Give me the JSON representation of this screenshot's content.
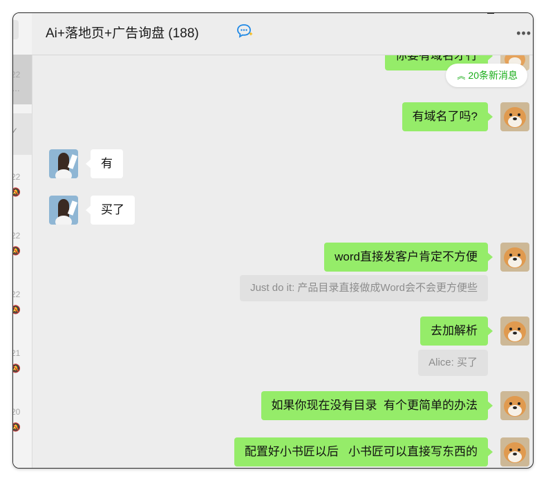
{
  "window": {
    "title": "Ai+落地页+广告询盘 (188)",
    "more_label": "•••"
  },
  "session_strip": {
    "items": [
      {
        "time": "22",
        "preview": "…",
        "state": "active"
      },
      {
        "time": "",
        "preview": "✓",
        "state": "hover"
      },
      {
        "time": "22",
        "preview": "",
        "state": "normal"
      },
      {
        "time": "22",
        "preview": "",
        "state": "normal"
      },
      {
        "time": "22",
        "preview": "",
        "state": "normal"
      },
      {
        "time": "21",
        "preview": "",
        "state": "normal"
      },
      {
        "time": "20",
        "preview": "",
        "state": "normal"
      }
    ]
  },
  "new_messages": {
    "label": "20条新消息",
    "icon": "double-chevron-up-icon"
  },
  "messages": [
    {
      "side": "me",
      "text": "你要有域名才行"
    },
    {
      "side": "me",
      "text": "有域名了吗?"
    },
    {
      "side": "other",
      "text": "有"
    },
    {
      "side": "other",
      "text": "买了"
    },
    {
      "side": "me",
      "text": "word直接发客户肯定不方便",
      "quote": "Just do it: 产品目录直接做成Word会不会更方便些"
    },
    {
      "side": "me",
      "text": "去加解析",
      "quote": "Alice: 买了"
    },
    {
      "side": "me",
      "text": "如果你现在没有目录  有个更简单的办法"
    },
    {
      "side": "me",
      "text": "配置好小书匠以后   小书匠可以直接写东西的"
    }
  ],
  "colors": {
    "my_bubble": "#95ec69",
    "other_bubble": "#ffffff",
    "chat_bg": "#ededed",
    "accent_green": "#1aad19"
  }
}
